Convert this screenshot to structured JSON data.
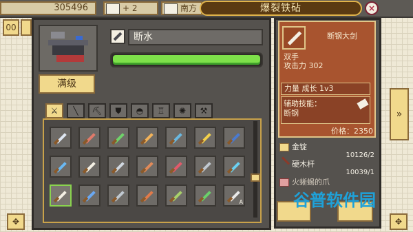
{
  "topbar": {
    "coins": "305496",
    "resource_2": "+ 2",
    "resource_3": "南方"
  },
  "title": "爆裂铁砧",
  "close_glyph": "×",
  "left_nav_glyph": "00",
  "forge": {
    "max_button": "满级",
    "item_name": "断水",
    "progress_fraction": 1.0
  },
  "tabs": [
    {
      "name": "sword",
      "glyph": "⚔",
      "active": true
    },
    {
      "name": "spear",
      "glyph": "╲",
      "active": false
    },
    {
      "name": "axe",
      "glyph": "⛏",
      "active": false
    },
    {
      "name": "shield",
      "glyph": "⛊",
      "active": false
    },
    {
      "name": "helmet",
      "glyph": "◓",
      "active": false
    },
    {
      "name": "armor",
      "glyph": "♖",
      "active": false
    },
    {
      "name": "ring",
      "glyph": "✺",
      "active": false
    },
    {
      "name": "tool",
      "glyph": "⚒",
      "active": false
    }
  ],
  "grid_colors": [
    [
      "#dfe7f2",
      "#e07a6a",
      "#6fd36a",
      "#f2b35a",
      "#6ab8e0",
      "#f2d04a",
      "#4a7ad0"
    ],
    [
      "#6ab8f2",
      "#f4f0e4",
      "#d0d8e0",
      "#e08a5a",
      "#e05a6a",
      "#c0c8d0",
      "#6ad0f2"
    ],
    [
      "#f4f0e4",
      "#6aa8f2",
      "#c0c8d0",
      "#e07a4a",
      "#a8d06a",
      "#6ad06a",
      "#e8e8e8"
    ]
  ],
  "grid_tag": "A",
  "detail": {
    "name": "断钢大剑",
    "hand": "双手",
    "attack": "攻击力 302",
    "stat": "力量 成长 1v3",
    "skill_label": "辅助技能：",
    "skill_name": "断钢",
    "price": "价格：2350"
  },
  "materials": [
    {
      "name": "金锭",
      "qty": ""
    },
    {
      "name": "硬木杆",
      "qty": "10126/2"
    },
    {
      "name": "",
      "qty": "10039/1"
    },
    {
      "name": "火蜥蜴的爪",
      "qty": ""
    }
  ],
  "side_arrow": "»",
  "watermark": "谷普软件园",
  "colors": {
    "progress": "#7ee04a",
    "detail_card": "#a8542f",
    "accent_gold": "#f1d98c"
  }
}
